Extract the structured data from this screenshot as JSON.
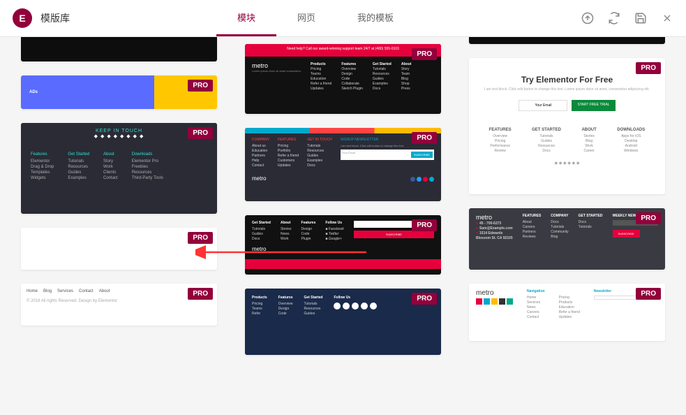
{
  "header": {
    "title": "模版库",
    "logo_letter": "E"
  },
  "tabs": [
    {
      "label": "模块",
      "active": true
    },
    {
      "label": "网页",
      "active": false
    },
    {
      "label": "我的模板",
      "active": false
    }
  ],
  "badge_text": "PRO",
  "templates": {
    "col1": [
      {
        "id": "footer-dark-1"
      },
      {
        "id": "footer-banner-1",
        "text": "ADs"
      },
      {
        "id": "footer-keep-in-touch",
        "heading": "KEEP IN TOUCH",
        "cols": [
          {
            "h": "Features",
            "items": [
              "Elementor",
              "Drag & Drop",
              "Templates",
              "Widgets"
            ]
          },
          {
            "h": "Get Started",
            "items": [
              "Tutorials",
              "Resources",
              "Guides",
              "Examples"
            ]
          },
          {
            "h": "About",
            "items": [
              "Story",
              "Work",
              "Clients",
              "Contact"
            ]
          },
          {
            "h": "Downloads",
            "items": [
              "Elementor Pro",
              "Freebies",
              "Resources",
              "Third-Party Tools"
            ]
          }
        ]
      },
      {
        "id": "footer-white-1"
      },
      {
        "id": "footer-nav-1",
        "nav": [
          "Home",
          "Blog",
          "Services",
          "Contact",
          "About"
        ],
        "copy": "© 2018 All rights Reserved. Design by Elementor"
      }
    ],
    "col2": [
      {
        "id": "footer-dark-0"
      },
      {
        "id": "footer-metro-red",
        "bar": "Need help? Call our award-winning support team 24/7 at (480) 555-0103",
        "logo": "metro",
        "cols": [
          {
            "h": "Products",
            "items": [
              "Pricing",
              "Teams",
              "Education",
              "Refer a friend",
              "Updates"
            ]
          },
          {
            "h": "Features",
            "items": [
              "Overview",
              "Design",
              "Code",
              "Collaborate",
              "Sketch Plugin"
            ]
          },
          {
            "h": "Get Started",
            "items": [
              "Tutorials",
              "Resources",
              "Guides",
              "Examples",
              "Docs"
            ]
          },
          {
            "h": "About",
            "items": [
              "Story",
              "Team",
              "Blog",
              "Shop",
              "Press"
            ]
          }
        ]
      },
      {
        "id": "footer-metro-teal",
        "logo": "metro",
        "cols": [
          {
            "h": "COMPANY",
            "items": [
              "About us",
              "Education",
              "Partners",
              "Help",
              "Contact"
            ]
          },
          {
            "h": "FEATURES",
            "items": [
              "Pricing",
              "Portfolio",
              "Refer a friend",
              "Customers",
              "Updates"
            ]
          },
          {
            "h": "GET IN TOUCH",
            "items": [
              "Tutorials",
              "Resources",
              "Guides",
              "Examples",
              "Docs"
            ]
          }
        ],
        "news": "SIGNUP NEWSLETTER",
        "placeholder": "Your Email",
        "btn": "SUBSCRIBE"
      },
      {
        "id": "footer-black-subscribe",
        "cols": [
          {
            "h": "Get Started",
            "items": [
              "Tutorials",
              "Guides",
              "Docs"
            ]
          },
          {
            "h": "About",
            "items": [
              "Stories",
              "News",
              "Work"
            ]
          },
          {
            "h": "Features",
            "items": [
              "Design",
              "Code",
              "Plugin"
            ]
          },
          {
            "h": "Follow Us",
            "items": [
              "Facebook",
              "Twitter",
              "Google+"
            ]
          }
        ],
        "btn": "SUBSCRIBE",
        "logo": "metro"
      },
      {
        "id": "footer-mountain",
        "cols": [
          {
            "h": "Products",
            "items": [
              "Pricing",
              "Teams",
              "Refer"
            ]
          },
          {
            "h": "Features",
            "items": [
              "Overview",
              "Design",
              "Code"
            ]
          },
          {
            "h": "Get Started",
            "items": [
              "Tutorials",
              "Resources",
              "Guides"
            ]
          }
        ],
        "follow": "Follow Us"
      }
    ],
    "col3": [
      {
        "id": "footer-dark-2"
      },
      {
        "id": "footer-try-elementor",
        "heading": "Try Elementor For Free",
        "desc": "I am text block. Click edit button to change this text. Lorem ipsum dolor sit amet, consectetur adipiscing elit.",
        "placeholder": "Your Email",
        "btn": "START FREE TRIAL",
        "cols": [
          {
            "h": "FEATURES",
            "items": [
              "Overview",
              "Pricing",
              "Performance",
              "Review"
            ]
          },
          {
            "h": "GET STARTED",
            "items": [
              "Tutorials",
              "Guides",
              "Resources",
              "Docs"
            ]
          },
          {
            "h": "ABOUT",
            "items": [
              "Stories",
              "Blog",
              "Work",
              "Career"
            ]
          },
          {
            "h": "DOWNLOADS",
            "items": [
              "Apps for iOS",
              "Desktop",
              "Android",
              "Windows"
            ]
          }
        ]
      },
      {
        "id": "footer-metro-gray",
        "logo": "metro",
        "cols": [
          {
            "h": "FEATURES",
            "items": [
              "45 - 700-6273",
              "Sam@Example.com",
              "1514 Edwards",
              "Blossom St. CA 92105"
            ]
          },
          {
            "h": "COMPANY",
            "items": [
              "About",
              "Careers",
              "Partners",
              "Reviews"
            ]
          },
          {
            "h": "GET STARTED",
            "items": [
              "Docs",
              "Tutorials",
              "Community",
              "Blog"
            ]
          },
          {
            "h": "WEEKLY NEWSLETTER",
            "items": []
          }
        ],
        "placeholder": "Email",
        "btn": "SUBSCRIBE"
      },
      {
        "id": "footer-metro-light",
        "logo": "metro",
        "cols": [
          {
            "h": "Navigation",
            "items": [
              "Home",
              "Services",
              "News",
              "Careers",
              "Contact"
            ]
          },
          {
            "h": "",
            "items": [
              "Pricing",
              "Products",
              "Education",
              "Refer a friend",
              "Updates"
            ]
          },
          {
            "h": "Newsletter",
            "items": []
          }
        ]
      }
    ]
  }
}
